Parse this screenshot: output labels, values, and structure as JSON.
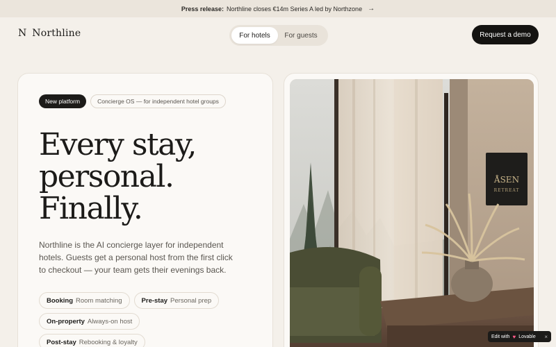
{
  "announcement": {
    "label": "Press release:",
    "text": "Northline closes €14m Series A led by Northzone",
    "arrow": "→"
  },
  "nav": {
    "brand_mark": "N",
    "brand_name": "Northline",
    "segment": [
      {
        "label": "For hotels",
        "active": true
      },
      {
        "label": "For guests",
        "active": false
      }
    ],
    "cta": "Request a demo"
  },
  "hero": {
    "badge_dark": "New platform",
    "badge_light": "Concierge OS — for independent hotel groups",
    "headline": [
      "Every stay,",
      "personal.",
      "Finally."
    ],
    "description": "Northline is the AI concierge layer for independent hotels. Guests get a personal host from the first click to checkout — your team gets their evenings back.",
    "chips": [
      [
        {
          "key": "Booking",
          "value": "Room matching"
        },
        {
          "key": "Pre-stay",
          "value": "Personal prep"
        }
      ],
      [
        {
          "key": "On-property",
          "value": "Always-on host"
        }
      ],
      [
        {
          "key": "Post-stay",
          "value": "Rebooking & loyalty"
        }
      ]
    ]
  },
  "photo": {
    "sign_line1": "ÅSEN",
    "sign_line2": "RETREAT"
  },
  "badge": {
    "edit": "Edit with",
    "brand": "Lovable",
    "close": "×"
  },
  "colors": {
    "background": "#f4f0ea",
    "announcement_bg": "#ebe5dc",
    "cta_bg": "#141311",
    "card_bg": "#fbf9f6"
  }
}
